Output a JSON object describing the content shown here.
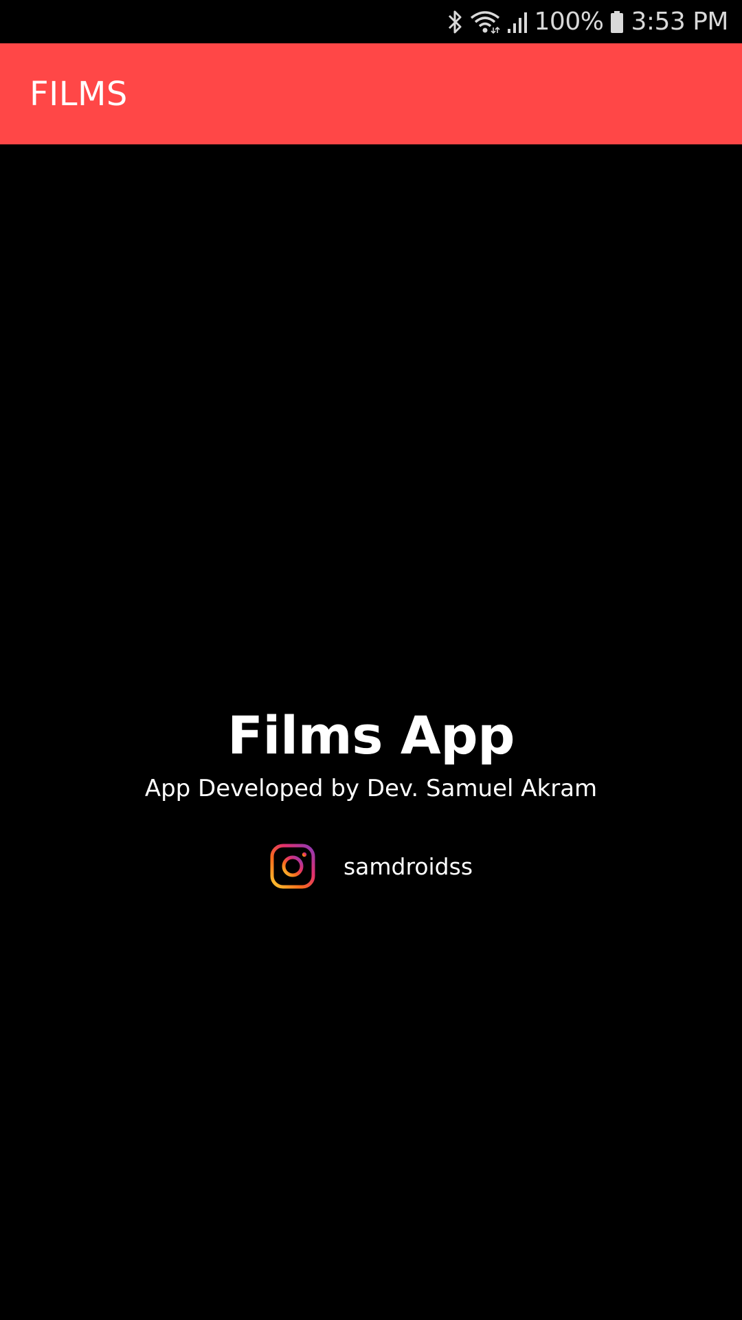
{
  "status_bar": {
    "icons": [
      "bluetooth-icon",
      "wifi-icon",
      "signal-icon",
      "battery-icon"
    ],
    "battery": "100%",
    "time": "3:53 PM"
  },
  "app_bar": {
    "title": "FILMS",
    "color": "#ff4747"
  },
  "about": {
    "app_name": "Films App",
    "developer": "App Developed by Dev. Samuel Akram",
    "social": {
      "icon": "instagram-icon",
      "handle": "samdroidss"
    }
  }
}
